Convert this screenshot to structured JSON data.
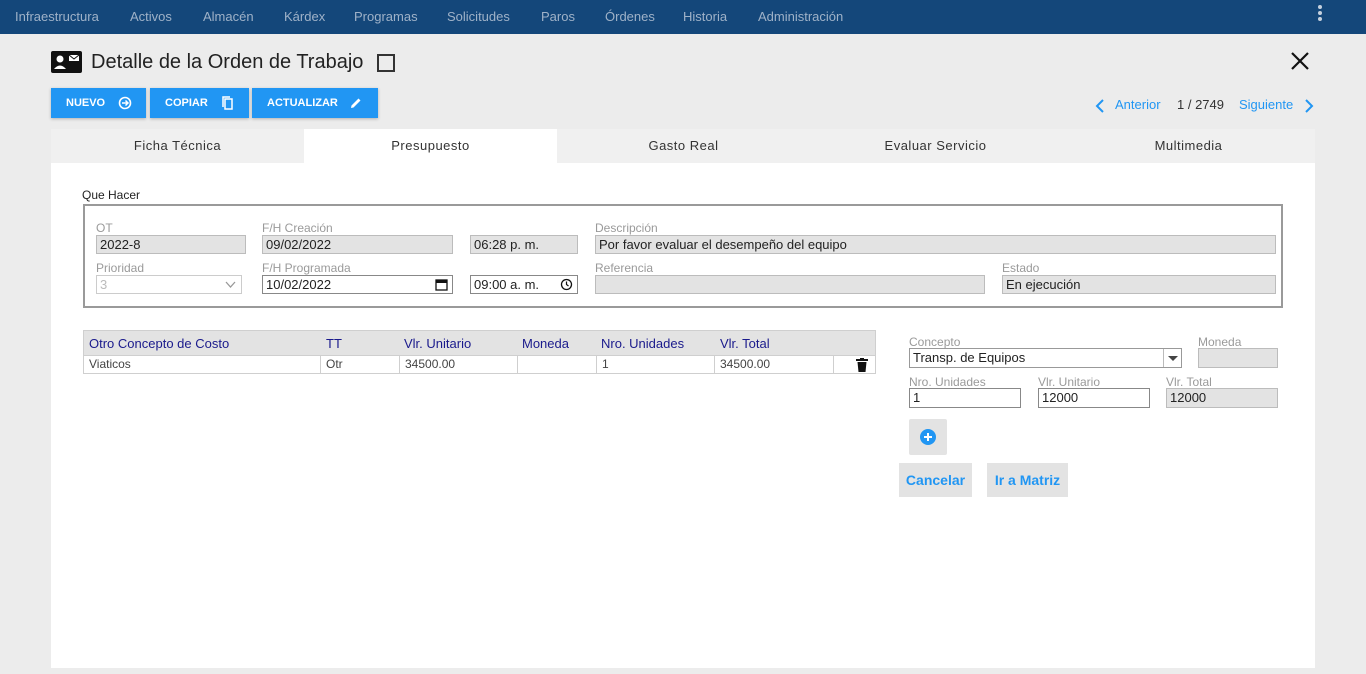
{
  "nav": {
    "items": [
      "Infraestructura",
      "Activos",
      "Almacén",
      "Kárdex",
      "Programas",
      "Solicitudes",
      "Paros",
      "Órdenes",
      "Historia",
      "Administración"
    ]
  },
  "header": {
    "title": "Detalle de la Orden de Trabajo",
    "icon": "contact-card-icon"
  },
  "toolbar": {
    "new_label": "NUEVO",
    "copy_label": "COPIAR",
    "update_label": "ACTUALIZAR"
  },
  "pager": {
    "prev_label": "Anterior",
    "count": "1 / 2749",
    "next_label": "Siguiente"
  },
  "tabs": [
    "Ficha Técnica",
    "Presupuesto",
    "Gasto Real",
    "Evaluar Servicio",
    "Multimedia"
  ],
  "active_tab": "Presupuesto",
  "que_hacer": {
    "section_label": "Que Hacer",
    "ot_label": "OT",
    "ot_value": "2022-8",
    "creacion_label": "F/H Creación",
    "creacion_date": "09/02/2022",
    "creacion_time": "06:28  p. m.",
    "descripcion_label": "Descripción",
    "descripcion_value": "Por favor evaluar el desempeño del equipo",
    "prioridad_label": "Prioridad",
    "prioridad_value": "3",
    "programada_label": "F/H Programada",
    "programada_date": "10/02/2022",
    "programada_time": "09:00  a. m.",
    "referencia_label": "Referencia",
    "referencia_value": "",
    "estado_label": "Estado",
    "estado_value": "En ejecución"
  },
  "cost_grid": {
    "headers": [
      "Otro Concepto de Costo",
      "TT",
      "Vlr. Unitario",
      "Moneda",
      "Nro. Unidades",
      "Vlr. Total"
    ],
    "rows": [
      {
        "concepto": "Viaticos",
        "tt": "Otr",
        "unitario": "34500.00",
        "moneda": "",
        "unidades": "1",
        "total": "34500.00"
      }
    ]
  },
  "form": {
    "concepto_label": "Concepto",
    "concepto_value": "Transp. de Equipos",
    "moneda_label": "Moneda",
    "moneda_value": "",
    "unidades_label": "Nro. Unidades",
    "unidades_value": "1",
    "unitario_label": "Vlr. Unitario",
    "unitario_value": "12000",
    "total_label": "Vlr. Total",
    "total_value": "12000",
    "cancel_label": "Cancelar",
    "matrix_label": "Ir a Matriz"
  },
  "colors": {
    "navbar": "#14477a",
    "primary": "#2196f3",
    "grid_header_text": "#1a1a8c"
  }
}
